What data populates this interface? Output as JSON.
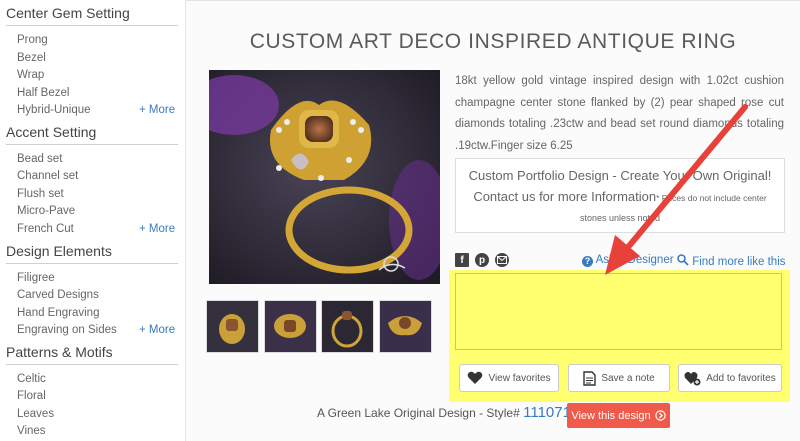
{
  "sidebar": {
    "sections": [
      {
        "title": "Center Gem Setting",
        "items": [
          "Prong",
          "Bezel",
          "Wrap",
          "Half Bezel",
          "Hybrid-Unique"
        ],
        "more": "+ More"
      },
      {
        "title": "Accent Setting",
        "items": [
          "Bead set",
          "Channel set",
          "Flush set",
          "Micro-Pave",
          "French Cut"
        ],
        "more": "+ More"
      },
      {
        "title": "Design Elements",
        "items": [
          "Filigree",
          "Carved Designs",
          "Hand Engraving",
          "Engraving on Sides"
        ],
        "more": "+ More"
      },
      {
        "title": "Patterns & Motifs",
        "items": [
          "Celtic",
          "Floral",
          "Leaves",
          "Vines"
        ]
      }
    ]
  },
  "product": {
    "title": "CUSTOM ART DECO INSPIRED ANTIQUE RING",
    "description": "18kt yellow gold vintage inspired design with 1.02ct cushion champagne center stone flanked by (2) pear shaped rose cut diamonds totaling .23ctw and bead set round diamonds totaling .19ctw.Finger size 6.25",
    "info_line1": "Custom Portfolio Design - Create Your Own Original!",
    "info_line2": "Contact us for more Information",
    "info_line2_small": "* Prices do not include center",
    "info_line3": "stones unless noted",
    "ask_designer": "Ask a Designer",
    "find_more": "Find more like this",
    "style_prefix": "A Green Lake Original Design - Style#",
    "style_number": "111071",
    "view_button": "View this design"
  },
  "share_icons": [
    "facebook-icon",
    "pinterest-icon",
    "email-icon"
  ],
  "buttons": {
    "view_favorites": "View favorites",
    "save_note": "Save a note",
    "add_favorites": "Add to favorites"
  },
  "colors": {
    "accent_blue": "#3a7bbf",
    "highlight_yellow": "#ffff70",
    "cta_red": "#f05a4b",
    "annotation_arrow": "#e8413a"
  }
}
